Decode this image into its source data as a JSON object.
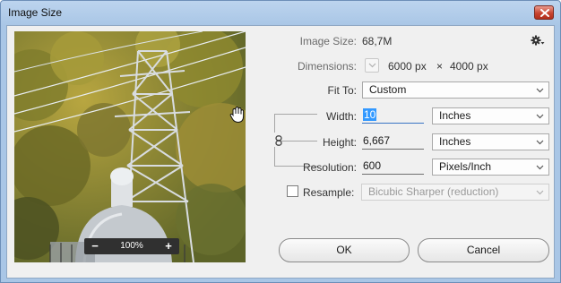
{
  "window": {
    "title": "Image Size"
  },
  "preview": {
    "zoom_value": "100%",
    "zoom_minus": "−",
    "zoom_plus": "+"
  },
  "image_size": {
    "label": "Image Size:",
    "value": "68,7M"
  },
  "dimensions": {
    "label": "Dimensions:",
    "width": "6000 px",
    "times": "×",
    "height": "4000 px"
  },
  "fit_to": {
    "label": "Fit To:",
    "value": "Custom"
  },
  "width": {
    "label": "Width:",
    "value": "10",
    "unit": "Inches"
  },
  "height": {
    "label": "Height:",
    "value": "6,667",
    "unit": "Inches"
  },
  "resolution": {
    "label": "Resolution:",
    "value": "600",
    "unit": "Pixels/Inch"
  },
  "resample": {
    "label": "Resample:",
    "checked": false,
    "value": "Bicubic Sharper (reduction)"
  },
  "buttons": {
    "ok": "OK",
    "cancel": "Cancel"
  },
  "icons": {
    "settings": "gear-icon",
    "link": "chain-link-icon",
    "cursor": "hand-cursor-icon",
    "close": "close-icon"
  },
  "colors": {
    "title_bar": "#a9c6e6",
    "close_button": "#c7432f",
    "selection": "#3399ff"
  }
}
